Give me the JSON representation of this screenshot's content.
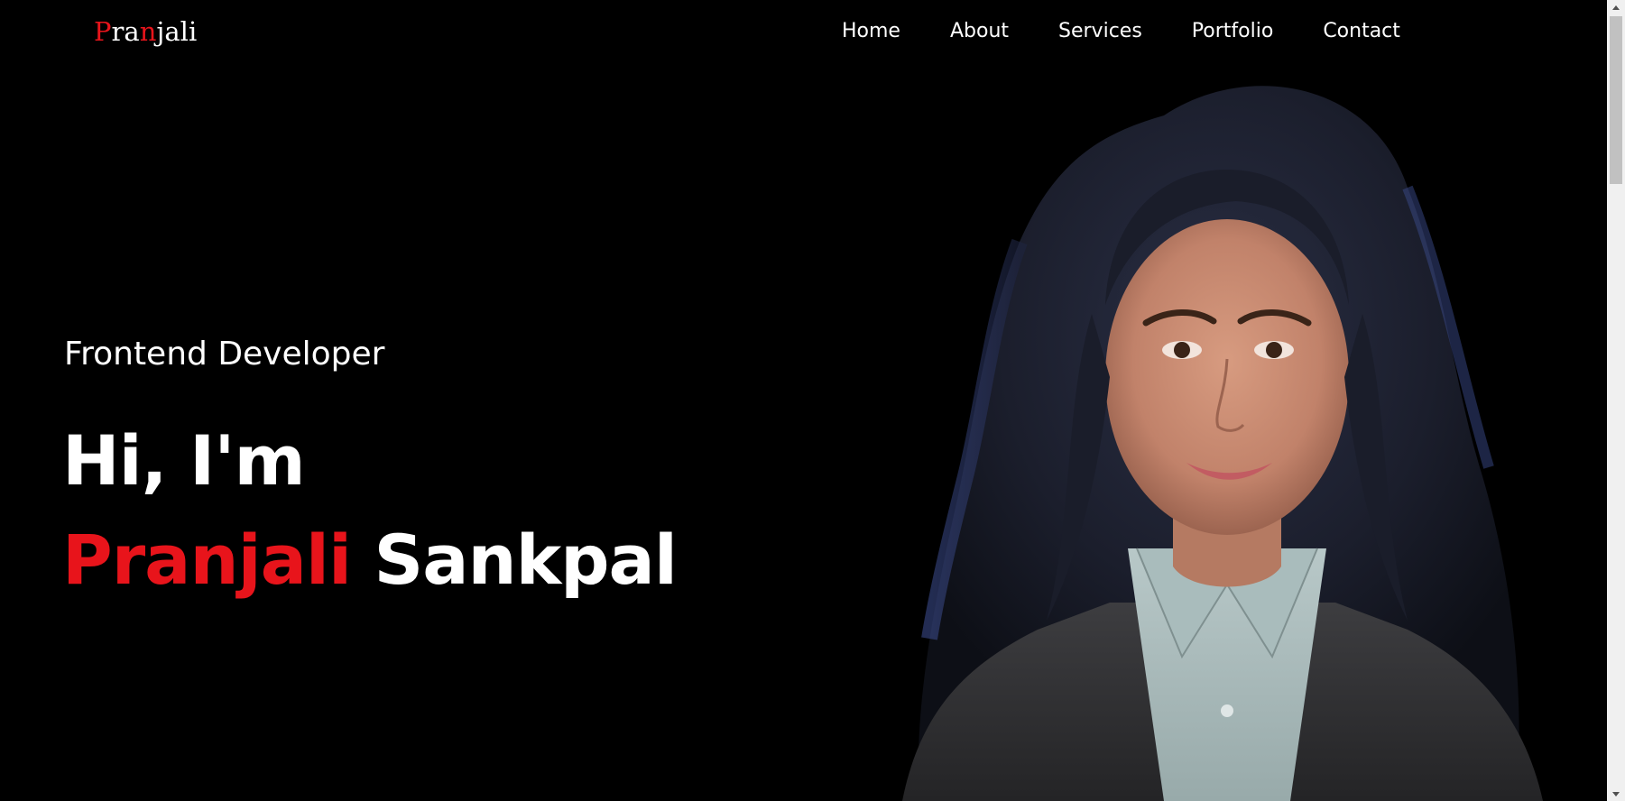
{
  "logo": {
    "letters": [
      {
        "char": "P",
        "accent": true
      },
      {
        "char": "r",
        "accent": false
      },
      {
        "char": "a",
        "accent": false
      },
      {
        "char": "n",
        "accent": true
      },
      {
        "char": "j",
        "accent": false
      },
      {
        "char": "a",
        "accent": false
      },
      {
        "char": "l",
        "accent": false
      },
      {
        "char": "i",
        "accent": false
      }
    ]
  },
  "nav": {
    "items": [
      {
        "label": "Home"
      },
      {
        "label": "About"
      },
      {
        "label": "Services"
      },
      {
        "label": "Portfolio"
      },
      {
        "label": "Contact"
      }
    ]
  },
  "hero": {
    "subtitle": "Frontend Developer",
    "greeting": "Hi, I'm",
    "first_name": "Pranjali",
    "last_name": "Sankpal"
  },
  "colors": {
    "background": "#000000",
    "accent": "#e8141b",
    "text": "#ffffff"
  },
  "icons": {
    "scroll_up": "triangle-up-icon",
    "scroll_down": "triangle-down-icon"
  }
}
